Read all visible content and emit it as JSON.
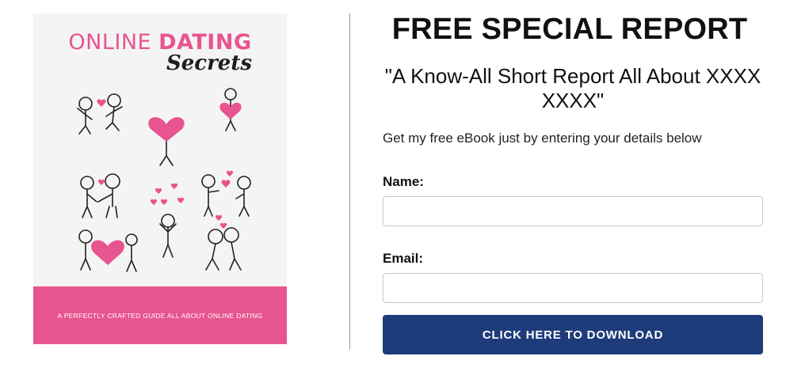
{
  "cover": {
    "title_light": "ONLINE ",
    "title_bold": "DATING",
    "subtitle": "Secrets",
    "tagline": "A PERFECTLY CRAFTED GUIDE ALL ABOUT ONLINE DATING",
    "accent_color": "#e7548f",
    "illustration": "stick-figure-couples-with-hearts"
  },
  "panel": {
    "headline": "FREE SPECIAL REPORT",
    "subheadline": "\"A Know-All Short Report All About XXXX XXXX\"",
    "lead": "Get my free eBook just by entering your details below",
    "form": {
      "name_label": "Name:",
      "name_value": "",
      "email_label": "Email:",
      "email_value": "",
      "submit_label": "CLICK HERE TO DOWNLOAD"
    },
    "button_color": "#1f3c7a"
  }
}
